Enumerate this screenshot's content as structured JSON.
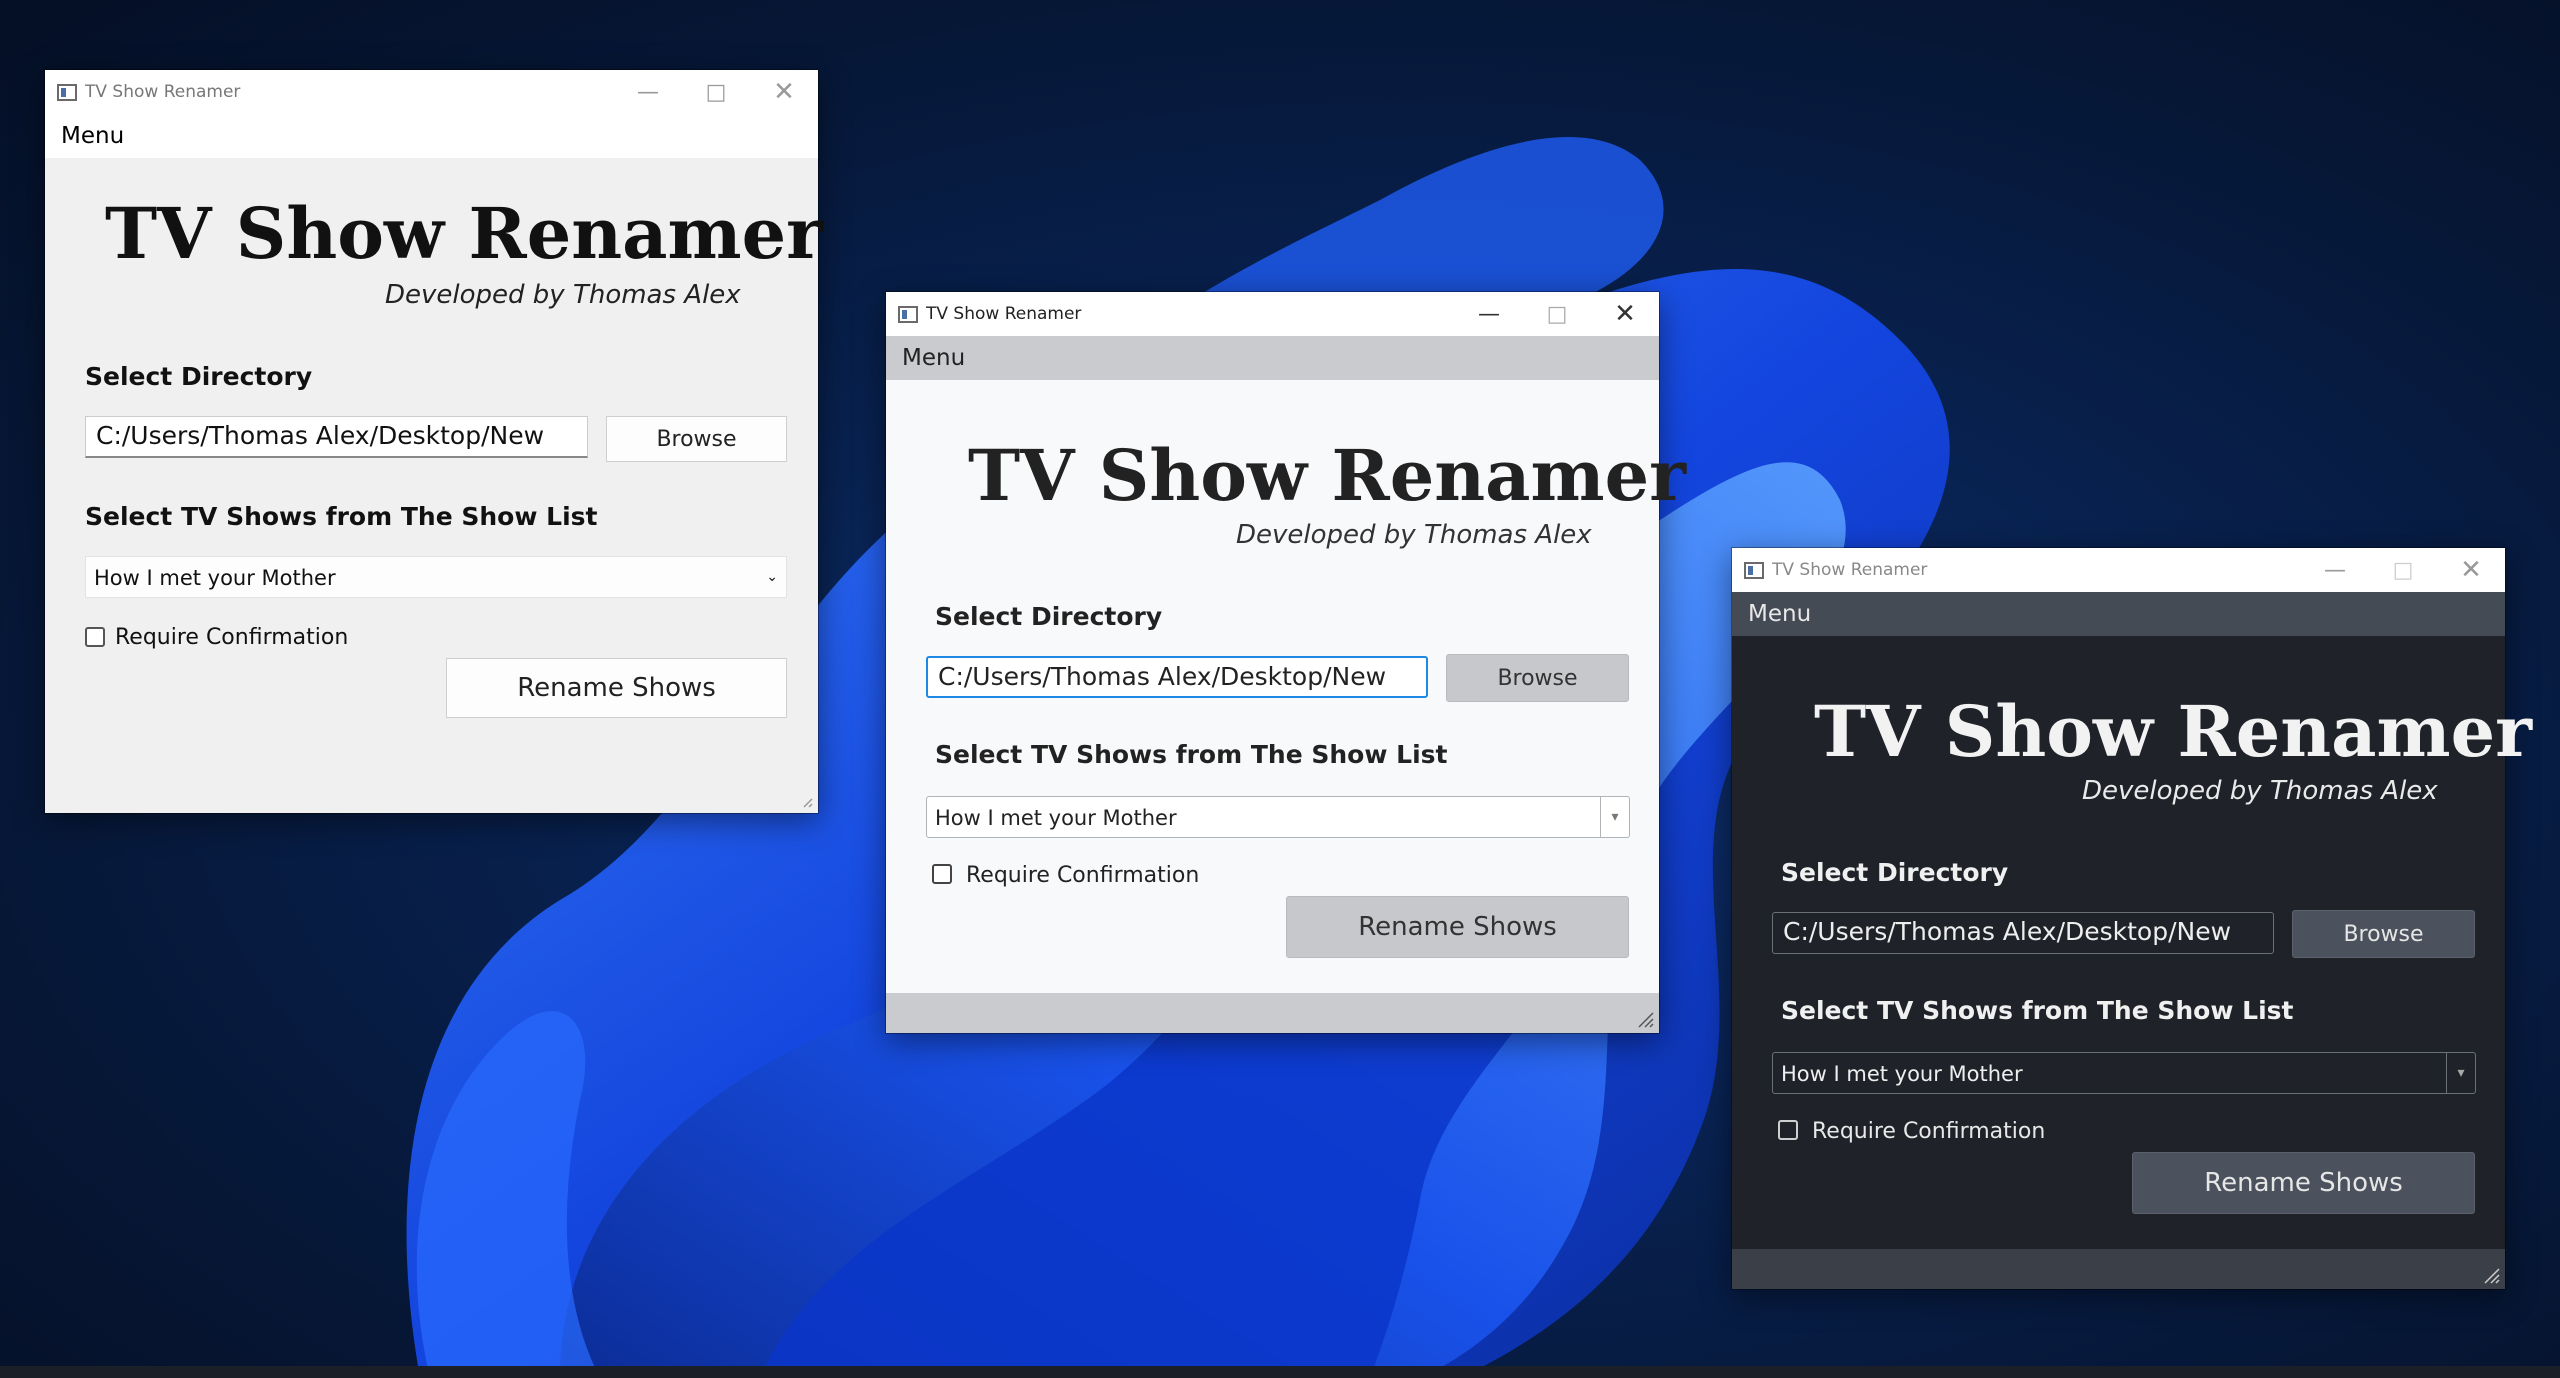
{
  "desktop": {
    "colors": {
      "wallpaper": "#071a3c",
      "bloom": "#1d5cff"
    }
  },
  "windows": [
    {
      "theme": "light-classic",
      "title": "TV Show Renamer",
      "menu": "Menu",
      "heading": "TV Show Renamer",
      "subtitle": "Developed by Thomas Alex",
      "directory_label": "Select Directory",
      "directory_value": "C:/Users/Thomas Alex/Desktop/New",
      "browse_label": "Browse",
      "shows_label": "Select TV Shows from The Show List",
      "show_selected": "How I met your Mother",
      "require_label": "Require Confirmation",
      "require_checked": false,
      "rename_label": "Rename Shows"
    },
    {
      "theme": "light",
      "title": "TV Show Renamer",
      "menu": "Menu",
      "heading": "TV Show Renamer",
      "subtitle": "Developed by Thomas Alex",
      "directory_label": "Select Directory",
      "directory_value": "C:/Users/Thomas Alex/Desktop/New",
      "browse_label": "Browse",
      "shows_label": "Select TV Shows from The Show List",
      "show_selected": "How I met your Mother",
      "require_label": "Require Confirmation",
      "require_checked": false,
      "rename_label": "Rename Shows"
    },
    {
      "theme": "dark",
      "title": "TV Show Renamer",
      "menu": "Menu",
      "heading": "TV Show Renamer",
      "subtitle": "Developed by Thomas Alex",
      "directory_label": "Select Directory",
      "directory_value": "C:/Users/Thomas Alex/Desktop/New",
      "browse_label": "Browse",
      "shows_label": "Select TV Shows from The Show List",
      "show_selected": "How I met your Mother",
      "require_label": "Require Confirmation",
      "require_checked": false,
      "rename_label": "Rename Shows"
    }
  ],
  "icons": {
    "app": "app-window-icon",
    "minimize": "minimize-icon",
    "maximize": "maximize-icon",
    "close": "close-icon",
    "dropdown": "chevron-down-icon",
    "resize": "resize-grip-icon"
  }
}
